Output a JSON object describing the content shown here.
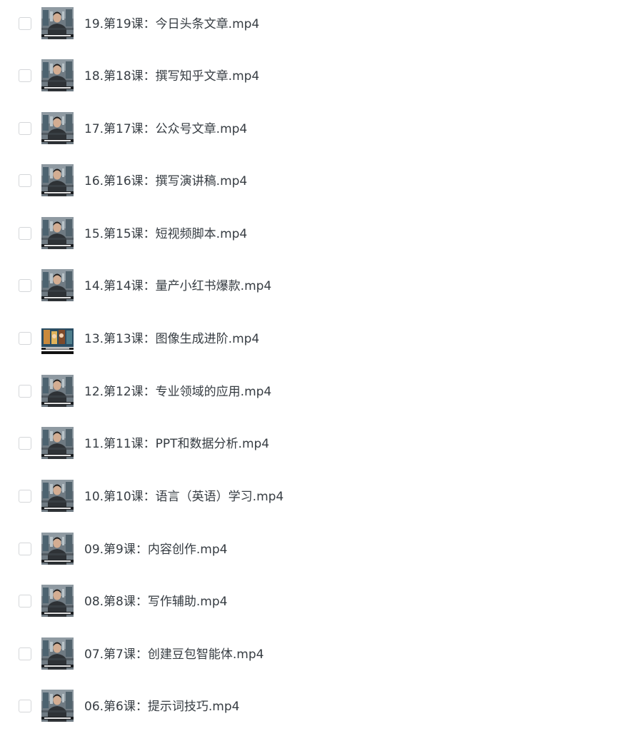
{
  "files": [
    {
      "name": "19.第19课：今日头条文章.mp4",
      "thumb": "person-video-thumbnail"
    },
    {
      "name": "18.第18课：撰写知乎文章.mp4",
      "thumb": "person-video-thumbnail"
    },
    {
      "name": "17.第17课：公众号文章.mp4",
      "thumb": "person-video-thumbnail"
    },
    {
      "name": "16.第16课：撰写演讲稿.mp4",
      "thumb": "person-video-thumbnail"
    },
    {
      "name": "15.第15课：短视频脚本.mp4",
      "thumb": "person-video-thumbnail"
    },
    {
      "name": "14.第14课：量产小红书爆款.mp4",
      "thumb": "person-video-thumbnail"
    },
    {
      "name": "13.第13课：图像生成进阶.mp4",
      "thumb": "illustration-video-thumbnail"
    },
    {
      "name": "12.第12课：专业领域的应用.mp4",
      "thumb": "person-video-thumbnail"
    },
    {
      "name": "11.第11课：PPT和数据分析.mp4",
      "thumb": "person-video-thumbnail"
    },
    {
      "name": "10.第10课：语言（英语）学习.mp4",
      "thumb": "person-video-thumbnail"
    },
    {
      "name": "09.第9课：内容创作.mp4",
      "thumb": "person-video-thumbnail"
    },
    {
      "name": "08.第8课：写作辅助.mp4",
      "thumb": "person-video-thumbnail"
    },
    {
      "name": "07.第7课：创建豆包智能体.mp4",
      "thumb": "person-video-thumbnail"
    },
    {
      "name": "06.第6课：提示词技巧.mp4",
      "thumb": "person-video-thumbnail"
    }
  ],
  "colors": {
    "text": "#363c42",
    "checkbox_border": "#d4d6d9",
    "background": "#ffffff"
  }
}
